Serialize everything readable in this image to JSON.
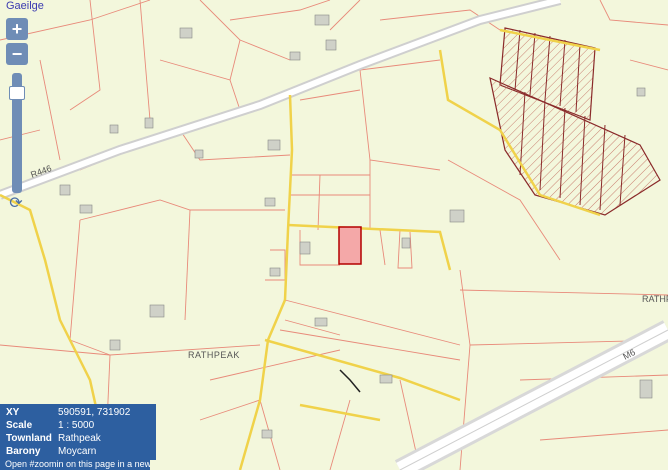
{
  "header": {
    "language_link": "Gaeilge"
  },
  "zoom": {
    "in_label": "+",
    "out_label": "−",
    "refresh_glyph": "⟳"
  },
  "map_labels": {
    "road_r446": "R446",
    "townland": "RATHPEAK",
    "road_m6": "M6",
    "edge_label": "RATHF"
  },
  "info": {
    "xy_label": "XY",
    "xy_value": "590591, 731902",
    "scale_label": "Scale",
    "scale_value": "1 : 5000",
    "townland_label": "Townland",
    "townland_value": "Rathpeak",
    "barony_label": "Barony",
    "barony_value": "Moycarn"
  },
  "footer": {
    "link_text": "Open #zoomin on this page in a new tab"
  },
  "colors": {
    "background": "#f3f7dc",
    "boundary": "#e88a7a",
    "road": "#f0d24a",
    "motorway": "#e2e2e2",
    "highlight": "#f4a8a8",
    "panel": "#2d5fa0"
  },
  "icons": {
    "refresh": "refresh-icon"
  }
}
